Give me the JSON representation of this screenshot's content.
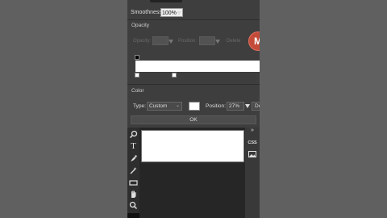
{
  "toolbar": {
    "smoothness_label": "Smoothness:",
    "smoothness_value": "100%"
  },
  "opacity": {
    "title": "Opacity",
    "opacity_label": "Opacity:",
    "position_label": "Position:",
    "delete_label": "Delete",
    "badge": "M"
  },
  "color": {
    "title": "Color",
    "type_label": "Type:",
    "type_value": "Custom",
    "swatch_color": "#ffffff",
    "position_label": "Position:",
    "position_value": "27%",
    "delete_label": "De"
  },
  "ok_label": "OK",
  "right_panel": {
    "double_arrow": "»",
    "css_label": "CSS"
  },
  "tools": [
    "zoom-icon",
    "text-icon",
    "pen-icon",
    "magic-wand-icon",
    "eraser-icon",
    "hand-icon",
    "zoom-tool-icon"
  ]
}
